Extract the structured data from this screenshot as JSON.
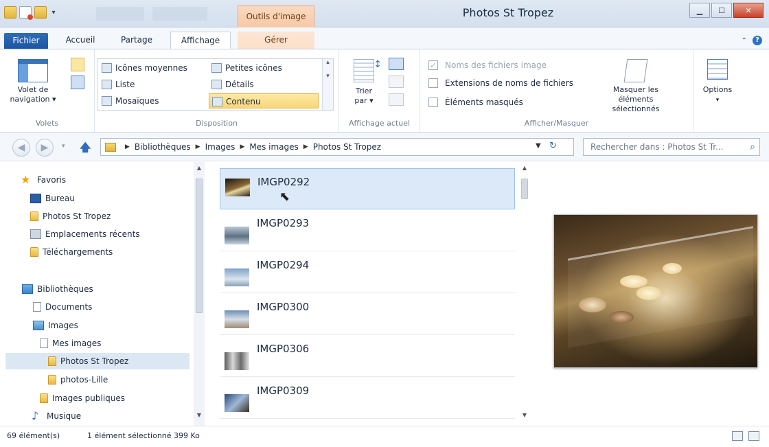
{
  "window": {
    "title": "Photos St Tropez",
    "context_tab": "Outils d'image"
  },
  "ribbon_tabs": [
    {
      "label": "Fichier"
    },
    {
      "label": "Accueil"
    },
    {
      "label": "Partage"
    },
    {
      "label": "Affichage"
    },
    {
      "label": "Gérer"
    }
  ],
  "panes_group": {
    "nav_pane_label": "Volet de navigation ▾",
    "label": "Volets"
  },
  "layout_group": {
    "label": "Disposition",
    "items": [
      {
        "label": "Icônes moyennes"
      },
      {
        "label": "Petites icônes"
      },
      {
        "label": "Liste"
      },
      {
        "label": "Détails"
      },
      {
        "label": "Mosaïques"
      },
      {
        "label": "Contenu"
      }
    ]
  },
  "current_view_group": {
    "sort_label": "Trier par ▾",
    "label": "Affichage actuel"
  },
  "show_hide_group": {
    "label": "Afficher/Masquer",
    "checkboxes": [
      {
        "label": "Noms des fichiers image",
        "checked": true,
        "enabled": false
      },
      {
        "label": "Extensions de noms de fichiers",
        "checked": false,
        "enabled": true
      },
      {
        "label": "Éléments masqués",
        "checked": false,
        "enabled": true
      }
    ],
    "hide_selected_label": "Masquer les éléments sélectionnés",
    "options_label": "Options"
  },
  "address": {
    "crumbs": [
      "Bibliothèques",
      "Images",
      "Mes images",
      "Photos St Tropez"
    ],
    "search_placeholder": "Rechercher dans : Photos St Tr..."
  },
  "nav_pane": {
    "items": [
      {
        "label": "Favoris",
        "icon": "star-icon"
      },
      {
        "label": "Bureau",
        "icon": "desktop-icon"
      },
      {
        "label": "Photos St Tropez",
        "icon": "folder-icon"
      },
      {
        "label": "Emplacements récents",
        "icon": "recent-places-icon"
      },
      {
        "label": "Téléchargements",
        "icon": "folder-icon"
      },
      {
        "label": "Bibliothèques",
        "icon": "library-icon"
      },
      {
        "label": "Documents",
        "icon": "document-library-icon"
      },
      {
        "label": "Images",
        "icon": "pictures-library-icon"
      },
      {
        "label": "Mes images",
        "icon": "document-library-icon"
      },
      {
        "label": "Photos St Tropez",
        "icon": "folder-icon"
      },
      {
        "label": "photos-Lille",
        "icon": "folder-icon"
      },
      {
        "label": "Images publiques",
        "icon": "folder-icon"
      },
      {
        "label": "Musique",
        "icon": "music-icon"
      }
    ]
  },
  "files": [
    {
      "name": "IMGP0292",
      "selected": true
    },
    {
      "name": "IMGP0293",
      "selected": false
    },
    {
      "name": "IMGP0294",
      "selected": false
    },
    {
      "name": "IMGP0300",
      "selected": false
    },
    {
      "name": "IMGP0306",
      "selected": false
    },
    {
      "name": "IMGP0309",
      "selected": false
    }
  ],
  "status": {
    "count": "69 élément(s)",
    "selection": "1 élément sélectionné  399 Ko"
  },
  "colors": {
    "accent": "#2f6cbf",
    "selection": "#dbe9f8",
    "context_tab": "#f7c9a7"
  }
}
